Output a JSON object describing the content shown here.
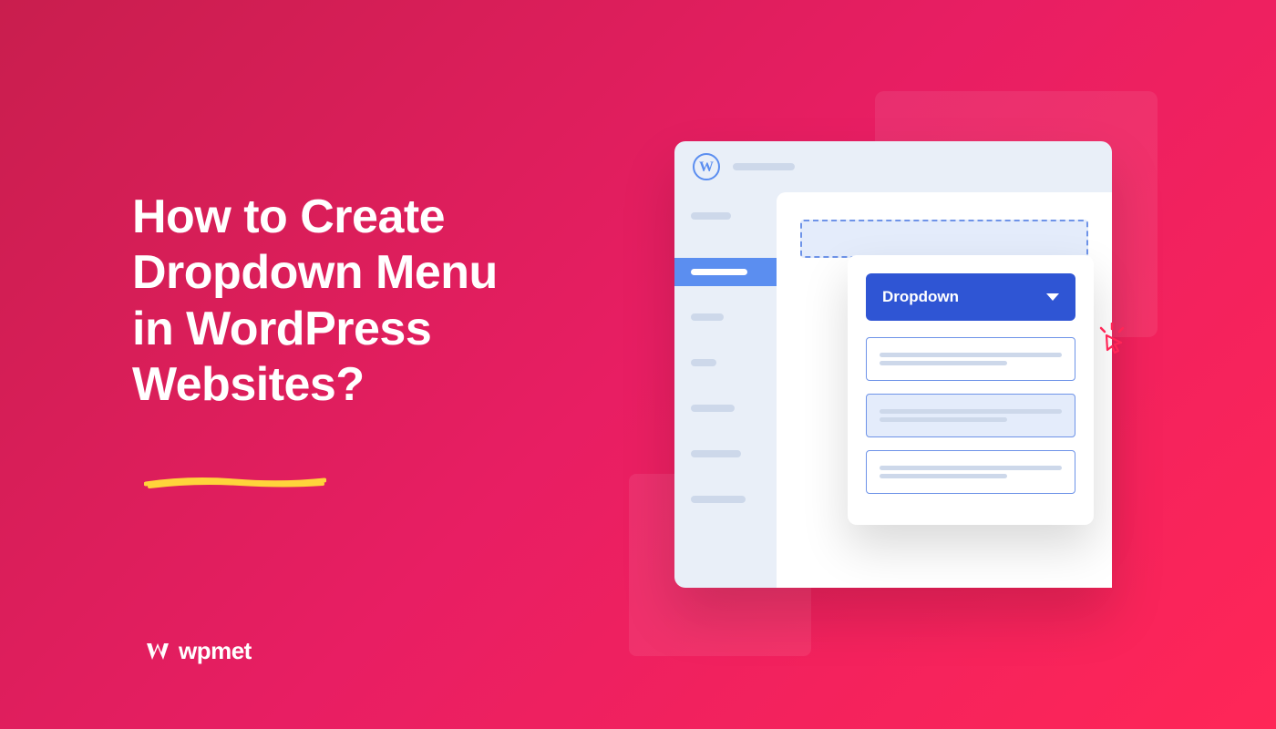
{
  "headline": {
    "line1": "How to Create",
    "line2": "Dropdown Menu",
    "line3": "in WordPress",
    "line4": "Websites?"
  },
  "brand": {
    "name": "wpmet"
  },
  "dropdown": {
    "button_label": "Dropdown"
  },
  "colors": {
    "accent": "#2f55d4",
    "highlight_yellow": "#ffd43b",
    "background_gradient_start": "#c91e4e",
    "background_gradient_end": "#ff2657"
  }
}
